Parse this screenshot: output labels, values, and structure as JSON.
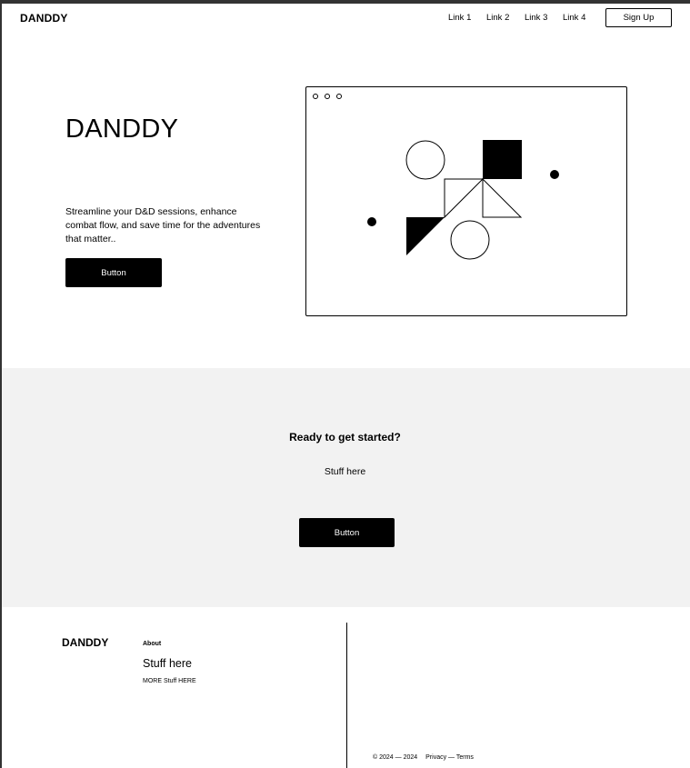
{
  "header": {
    "brand": "DANDDY",
    "links": [
      "Link 1",
      "Link 2",
      "Link 3",
      "Link 4"
    ],
    "signup_label": "Sign Up"
  },
  "hero": {
    "title": "DANDDY",
    "description": "Streamline your D&D sessions, enhance combat flow, and save time for the adventures that matter..",
    "button_label": "Button"
  },
  "cta": {
    "title": "Ready to get started?",
    "subtitle": "Stuff here",
    "button_label": "Button"
  },
  "footer": {
    "brand": "DANDDY",
    "about_label": "About",
    "stuff": "Stuff here",
    "more": "MORE Stuff HERE",
    "copyright": "© 2024 — 2024",
    "legal_link": "Privacy — Terms"
  },
  "colors": {
    "primary": "#000000",
    "cta_background": "#f2f2f2",
    "page_background": "#ffffff"
  }
}
